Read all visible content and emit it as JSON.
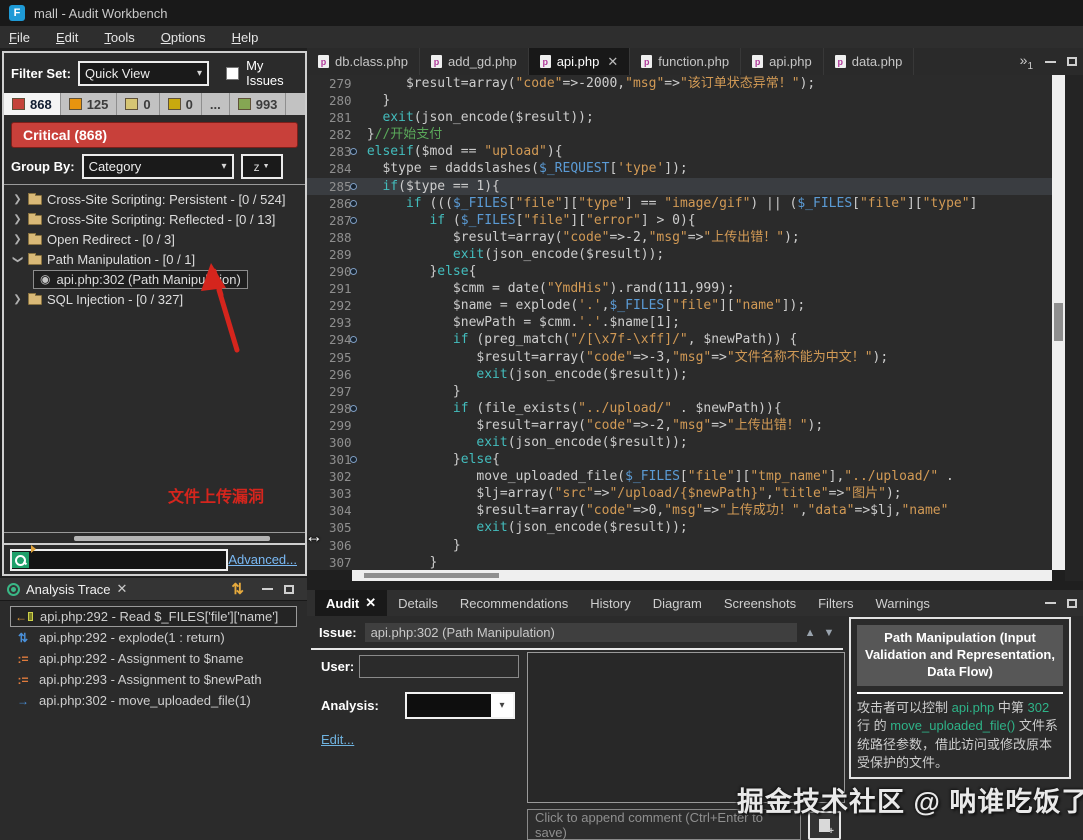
{
  "titlebar": {
    "title": "mall - Audit Workbench",
    "app_icon_letter": "F"
  },
  "menu": {
    "items": [
      "File",
      "Edit",
      "Tools",
      "Options",
      "Help"
    ]
  },
  "left_panel": {
    "filter_set_label": "Filter Set:",
    "filter_set_value": "Quick View",
    "my_issues_label": "My Issues",
    "counts": [
      {
        "label": "868",
        "swatch": "#c4433a",
        "selected": true
      },
      {
        "label": "125",
        "swatch": "#e8940f",
        "selected": false
      },
      {
        "label": "0",
        "swatch": "#eec91575",
        "selected": false
      },
      {
        "label": "0",
        "swatch": "#c9a90e",
        "selected": false
      },
      {
        "label": "...",
        "swatch": null,
        "selected": false
      },
      {
        "label": "993",
        "swatch": "#85a653",
        "selected": false
      }
    ],
    "severity_banner": "Critical (868)",
    "group_by_label": "Group By:",
    "group_by_value": "Category",
    "sort_button_label": "z",
    "tree": [
      {
        "label": "Cross-Site Scripting: Persistent - [0 / 524]",
        "type": "folder",
        "state": "collapsed",
        "selected": false
      },
      {
        "label": "Cross-Site Scripting: Reflected - [0 / 13]",
        "type": "folder",
        "state": "collapsed",
        "selected": false
      },
      {
        "label": "Open Redirect - [0 / 3]",
        "type": "folder",
        "state": "collapsed",
        "selected": false
      },
      {
        "label": "Path Manipulation - [0 / 1]",
        "type": "folder",
        "state": "expanded",
        "selected": false
      },
      {
        "label": "api.php:302 (Path Manipulation)",
        "type": "issue",
        "state": "leaf",
        "selected": true
      },
      {
        "label": "SQL Injection - [0 / 327]",
        "type": "folder",
        "state": "collapsed",
        "selected": false
      }
    ],
    "annotation_text": "文件上传漏洞",
    "annotation_color": "#d5251d",
    "advanced_link": "Advanced..."
  },
  "analysis_trace": {
    "title": "Analysis Trace",
    "items": [
      {
        "icon": "read-icon",
        "label": "api.php:292 - Read $_FILES['file']['name']",
        "selected": true
      },
      {
        "icon": "explode-icon",
        "label": "api.php:292 - explode(1 : return)",
        "selected": false
      },
      {
        "icon": "assignment-icon",
        "label": "api.php:292 - Assignment to $name",
        "selected": false
      },
      {
        "icon": "assignment-icon",
        "label": "api.php:293 - Assignment to $newPath",
        "selected": false
      },
      {
        "icon": "call-icon",
        "label": "api.php:302 - move_uploaded_file(1)",
        "selected": false
      }
    ]
  },
  "editor": {
    "tabs": [
      {
        "label": "db.class.php",
        "selected": false
      },
      {
        "label": "add_gd.php",
        "selected": false
      },
      {
        "label": "api.php",
        "selected": true
      },
      {
        "label": "function.php",
        "selected": false
      },
      {
        "label": "api.php",
        "selected": false
      },
      {
        "label": "data.php",
        "selected": false
      }
    ],
    "overflow_indicator": "»",
    "overflow_count": "1",
    "code": [
      {
        "n": 279,
        "m": false,
        "hl": false,
        "s": [
          [
            "pl",
            "      $result=array("
          ],
          [
            "st",
            "\"code\""
          ],
          [
            "pl",
            "=>-2000,"
          ],
          [
            "st",
            "\"msg\""
          ],
          [
            "pl",
            "=>"
          ],
          [
            "st",
            "\"该订单状态异常！\""
          ],
          [
            "pl",
            ");"
          ]
        ]
      },
      {
        "n": 280,
        "m": false,
        "hl": false,
        "s": [
          [
            "pl",
            "   }"
          ]
        ]
      },
      {
        "n": 281,
        "m": false,
        "hl": false,
        "s": [
          [
            "pl",
            "   "
          ],
          [
            "kw",
            "exit"
          ],
          [
            "pl",
            "(json_encode($result));"
          ]
        ]
      },
      {
        "n": 282,
        "m": false,
        "hl": false,
        "s": [
          [
            "pl",
            " }"
          ],
          [
            "cm",
            "//开始支付"
          ]
        ]
      },
      {
        "n": 283,
        "m": true,
        "hl": false,
        "s": [
          [
            "pl",
            " "
          ],
          [
            "kw",
            "elseif"
          ],
          [
            "pl",
            "($mod == "
          ],
          [
            "st",
            "\"upload\""
          ],
          [
            "pl",
            "){"
          ]
        ]
      },
      {
        "n": 284,
        "m": false,
        "hl": false,
        "s": [
          [
            "pl",
            "   $type = daddslashes("
          ],
          [
            "sg",
            "$_REQUEST"
          ],
          [
            "pl",
            "["
          ],
          [
            "st",
            "'type'"
          ],
          [
            "pl",
            "]);"
          ]
        ]
      },
      {
        "n": 285,
        "m": true,
        "hl": true,
        "s": [
          [
            "pl",
            "   "
          ],
          [
            "kw",
            "if"
          ],
          [
            "pl",
            "($type == 1){"
          ]
        ]
      },
      {
        "n": 286,
        "m": true,
        "hl": false,
        "s": [
          [
            "pl",
            "      "
          ],
          [
            "kw",
            "if"
          ],
          [
            "pl",
            " ((("
          ],
          [
            "sg",
            "$_FILES"
          ],
          [
            "pl",
            "["
          ],
          [
            "st",
            "\"file\""
          ],
          [
            "pl",
            "]["
          ],
          [
            "st",
            "\"type\""
          ],
          [
            "pl",
            "] == "
          ],
          [
            "st",
            "\"image/gif\""
          ],
          [
            "pl",
            ") || ("
          ],
          [
            "sg",
            "$_FILES"
          ],
          [
            "pl",
            "["
          ],
          [
            "st",
            "\"file\""
          ],
          [
            "pl",
            "]["
          ],
          [
            "st",
            "\"type\""
          ],
          [
            "pl",
            "]"
          ]
        ]
      },
      {
        "n": 287,
        "m": true,
        "hl": false,
        "s": [
          [
            "pl",
            "         "
          ],
          [
            "kw",
            "if"
          ],
          [
            "pl",
            " ("
          ],
          [
            "sg",
            "$_FILES"
          ],
          [
            "pl",
            "["
          ],
          [
            "st",
            "\"file\""
          ],
          [
            "pl",
            "]["
          ],
          [
            "st",
            "\"error\""
          ],
          [
            "pl",
            "] > 0){"
          ]
        ]
      },
      {
        "n": 288,
        "m": false,
        "hl": false,
        "s": [
          [
            "pl",
            "            $result=array("
          ],
          [
            "st",
            "\"code\""
          ],
          [
            "pl",
            "=>-2,"
          ],
          [
            "st",
            "\"msg\""
          ],
          [
            "pl",
            "=>"
          ],
          [
            "st",
            "\"上传出错！\""
          ],
          [
            "pl",
            ");"
          ]
        ]
      },
      {
        "n": 289,
        "m": false,
        "hl": false,
        "s": [
          [
            "pl",
            "            "
          ],
          [
            "kw",
            "exit"
          ],
          [
            "pl",
            "(json_encode($result));"
          ]
        ]
      },
      {
        "n": 290,
        "m": true,
        "hl": false,
        "s": [
          [
            "pl",
            "         }"
          ],
          [
            "kw",
            "else"
          ],
          [
            "pl",
            "{"
          ]
        ]
      },
      {
        "n": 291,
        "m": false,
        "hl": false,
        "s": [
          [
            "pl",
            "            $cmm = date("
          ],
          [
            "st",
            "\"YmdHis\""
          ],
          [
            "pl",
            ").rand(111,999);"
          ]
        ]
      },
      {
        "n": 292,
        "m": false,
        "hl": false,
        "s": [
          [
            "pl",
            "            $name = explode("
          ],
          [
            "st",
            "'.'"
          ],
          [
            "pl",
            ","
          ],
          [
            "sg",
            "$_FILES"
          ],
          [
            "pl",
            "["
          ],
          [
            "st",
            "\"file\""
          ],
          [
            "pl",
            "]["
          ],
          [
            "st",
            "\"name\""
          ],
          [
            "pl",
            "]);"
          ]
        ]
      },
      {
        "n": 293,
        "m": false,
        "hl": false,
        "s": [
          [
            "pl",
            "            $newPath = $cmm."
          ],
          [
            "st",
            "'.'"
          ],
          [
            "pl",
            ".$name[1];"
          ]
        ]
      },
      {
        "n": 294,
        "m": true,
        "hl": false,
        "s": [
          [
            "pl",
            "            "
          ],
          [
            "kw",
            "if"
          ],
          [
            "pl",
            " (preg_match("
          ],
          [
            "st",
            "\"/[\\x7f-\\xff]/\""
          ],
          [
            "pl",
            ", $newPath)) {"
          ]
        ]
      },
      {
        "n": 295,
        "m": false,
        "hl": false,
        "s": [
          [
            "pl",
            "               $result=array("
          ],
          [
            "st",
            "\"code\""
          ],
          [
            "pl",
            "=>-3,"
          ],
          [
            "st",
            "\"msg\""
          ],
          [
            "pl",
            "=>"
          ],
          [
            "st",
            "\"文件名称不能为中文！\""
          ],
          [
            "pl",
            ");"
          ]
        ]
      },
      {
        "n": 296,
        "m": false,
        "hl": false,
        "s": [
          [
            "pl",
            "               "
          ],
          [
            "kw",
            "exit"
          ],
          [
            "pl",
            "(json_encode($result));"
          ]
        ]
      },
      {
        "n": 297,
        "m": false,
        "hl": false,
        "s": [
          [
            "pl",
            "            }"
          ]
        ]
      },
      {
        "n": 298,
        "m": true,
        "hl": false,
        "s": [
          [
            "pl",
            "            "
          ],
          [
            "kw",
            "if"
          ],
          [
            "pl",
            " (file_exists("
          ],
          [
            "st",
            "\"../upload/\""
          ],
          [
            "pl",
            " . $newPath)){"
          ]
        ]
      },
      {
        "n": 299,
        "m": false,
        "hl": false,
        "s": [
          [
            "pl",
            "               $result=array("
          ],
          [
            "st",
            "\"code\""
          ],
          [
            "pl",
            "=>-2,"
          ],
          [
            "st",
            "\"msg\""
          ],
          [
            "pl",
            "=>"
          ],
          [
            "st",
            "\"上传出错！\""
          ],
          [
            "pl",
            ");"
          ]
        ]
      },
      {
        "n": 300,
        "m": false,
        "hl": false,
        "s": [
          [
            "pl",
            "               "
          ],
          [
            "kw",
            "exit"
          ],
          [
            "pl",
            "(json_encode($result));"
          ]
        ]
      },
      {
        "n": 301,
        "m": true,
        "hl": false,
        "s": [
          [
            "pl",
            "            }"
          ],
          [
            "kw",
            "else"
          ],
          [
            "pl",
            "{"
          ]
        ]
      },
      {
        "n": 302,
        "m": false,
        "hl": false,
        "s": [
          [
            "pl",
            "               move_uploaded_file("
          ],
          [
            "sg",
            "$_FILES"
          ],
          [
            "pl",
            "["
          ],
          [
            "st",
            "\"file\""
          ],
          [
            "pl",
            "]["
          ],
          [
            "st",
            "\"tmp_name\""
          ],
          [
            "pl",
            "],"
          ],
          [
            "st",
            "\"../upload/\""
          ],
          [
            "pl",
            " ."
          ]
        ]
      },
      {
        "n": 303,
        "m": false,
        "hl": false,
        "s": [
          [
            "pl",
            "               $lj=array("
          ],
          [
            "st",
            "\"src\""
          ],
          [
            "pl",
            "=>"
          ],
          [
            "st",
            "\"/upload/{$newPath}\""
          ],
          [
            "pl",
            ","
          ],
          [
            "st",
            "\"title\""
          ],
          [
            "pl",
            "=>"
          ],
          [
            "st",
            "\"图片\""
          ],
          [
            "pl",
            ");"
          ]
        ]
      },
      {
        "n": 304,
        "m": false,
        "hl": false,
        "s": [
          [
            "pl",
            "               $result=array("
          ],
          [
            "st",
            "\"code\""
          ],
          [
            "pl",
            "=>0,"
          ],
          [
            "st",
            "\"msg\""
          ],
          [
            "pl",
            "=>"
          ],
          [
            "st",
            "\"上传成功！\""
          ],
          [
            "pl",
            ","
          ],
          [
            "st",
            "\"data\""
          ],
          [
            "pl",
            "=>$lj,"
          ],
          [
            "st",
            "\"name\""
          ]
        ]
      },
      {
        "n": 305,
        "m": false,
        "hl": false,
        "s": [
          [
            "pl",
            "               "
          ],
          [
            "kw",
            "exit"
          ],
          [
            "pl",
            "(json_encode($result));"
          ]
        ]
      },
      {
        "n": 306,
        "m": false,
        "hl": false,
        "s": [
          [
            "pl",
            "            }"
          ]
        ]
      },
      {
        "n": 307,
        "m": false,
        "hl": false,
        "s": [
          [
            "pl",
            "         }"
          ]
        ]
      }
    ]
  },
  "audit": {
    "tabs": [
      {
        "label": "Audit",
        "selected": true
      },
      {
        "label": "Details",
        "selected": false
      },
      {
        "label": "Recommendations",
        "selected": false
      },
      {
        "label": "History",
        "selected": false
      },
      {
        "label": "Diagram",
        "selected": false
      },
      {
        "label": "Screenshots",
        "selected": false
      },
      {
        "label": "Filters",
        "selected": false
      },
      {
        "label": "Warnings",
        "selected": false
      }
    ],
    "issue_label": "Issue:",
    "issue_value": "api.php:302 (Path Manipulation)",
    "user_label": "User:",
    "user_value": "",
    "analysis_label": "Analysis:",
    "analysis_value": "",
    "edit_link": "Edit...",
    "comment_placeholder": "Click to append comment (Ctrl+Enter to save)",
    "info_panel": {
      "title": "Path Manipulation (Input Validation and Representation, Data Flow)",
      "highlight_color": "#2eb388",
      "body": [
        {
          "text": "攻击者可以控制 ",
          "hl": false
        },
        {
          "text": "api.php",
          "hl": true
        },
        {
          "text": " 中第 ",
          "hl": false
        },
        {
          "text": "302",
          "hl": true
        },
        {
          "text": " 行 的 ",
          "hl": false
        },
        {
          "text": "move_uploaded_file()",
          "hl": true
        },
        {
          "text": " 文件系统路径参数，借此访问或修改原本受保护的文件。",
          "hl": false
        }
      ]
    }
  },
  "watermark": "掘金技术社区 @ 呐谁吃饭了"
}
